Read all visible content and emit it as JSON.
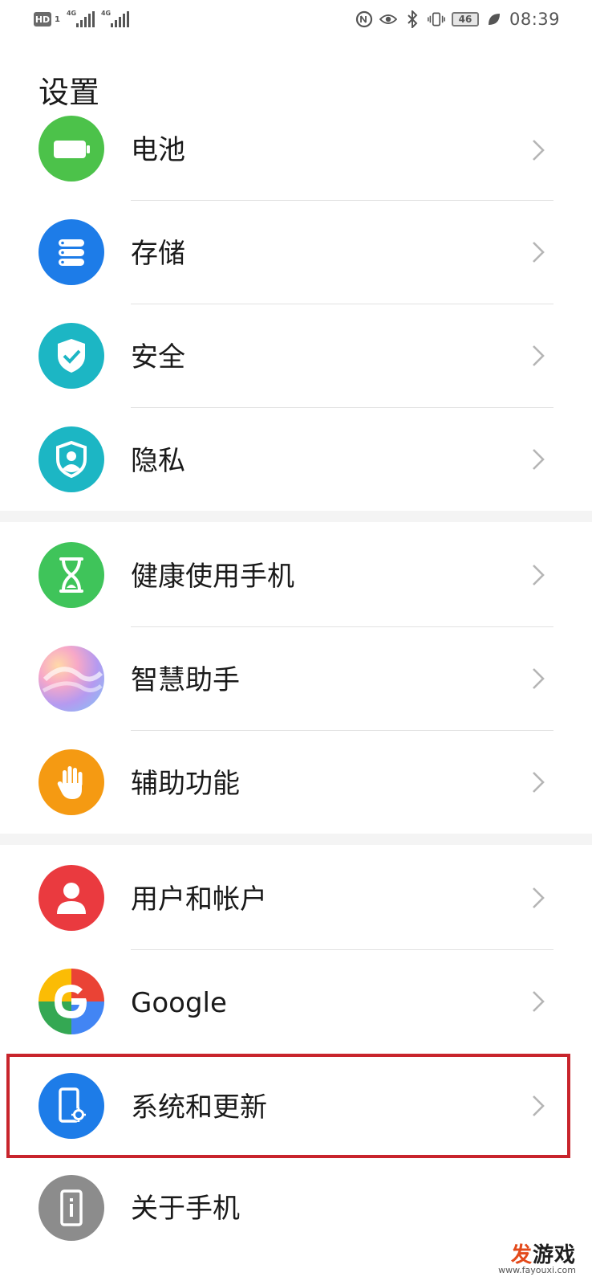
{
  "status_bar": {
    "hd": "HD",
    "sim": "1",
    "net1": "4G",
    "net2": "4G",
    "battery": "46",
    "time": "08:39"
  },
  "page_title": "设置",
  "items": [
    {
      "label": "电池",
      "icon": "battery-icon",
      "color": "#4cc24a"
    },
    {
      "label": "存储",
      "icon": "storage-icon",
      "color": "#1d7ce8"
    },
    {
      "label": "安全",
      "icon": "shield-check-icon",
      "color": "#1cb6c4"
    },
    {
      "label": "隐私",
      "icon": "privacy-icon",
      "color": "#1cb6c4"
    },
    {
      "label": "健康使用手机",
      "icon": "hourglass-icon",
      "color": "#3fc45a"
    },
    {
      "label": "智慧助手",
      "icon": "assistant-icon",
      "color": "#c8a8f0"
    },
    {
      "label": "辅助功能",
      "icon": "hand-icon",
      "color": "#f59a12"
    },
    {
      "label": "用户和帐户",
      "icon": "user-icon",
      "color": "#ea3a3f"
    },
    {
      "label": "Google",
      "icon": "google-icon",
      "color": "#4285f4"
    },
    {
      "label": "系统和更新",
      "icon": "phone-gear-icon",
      "color": "#1d7ce8"
    },
    {
      "label": "关于手机",
      "icon": "phone-info-icon",
      "color": "#8c8c8c"
    }
  ],
  "watermark": {
    "prefix": "发",
    "main": "游戏",
    "url": "www.fayouxi.com"
  }
}
